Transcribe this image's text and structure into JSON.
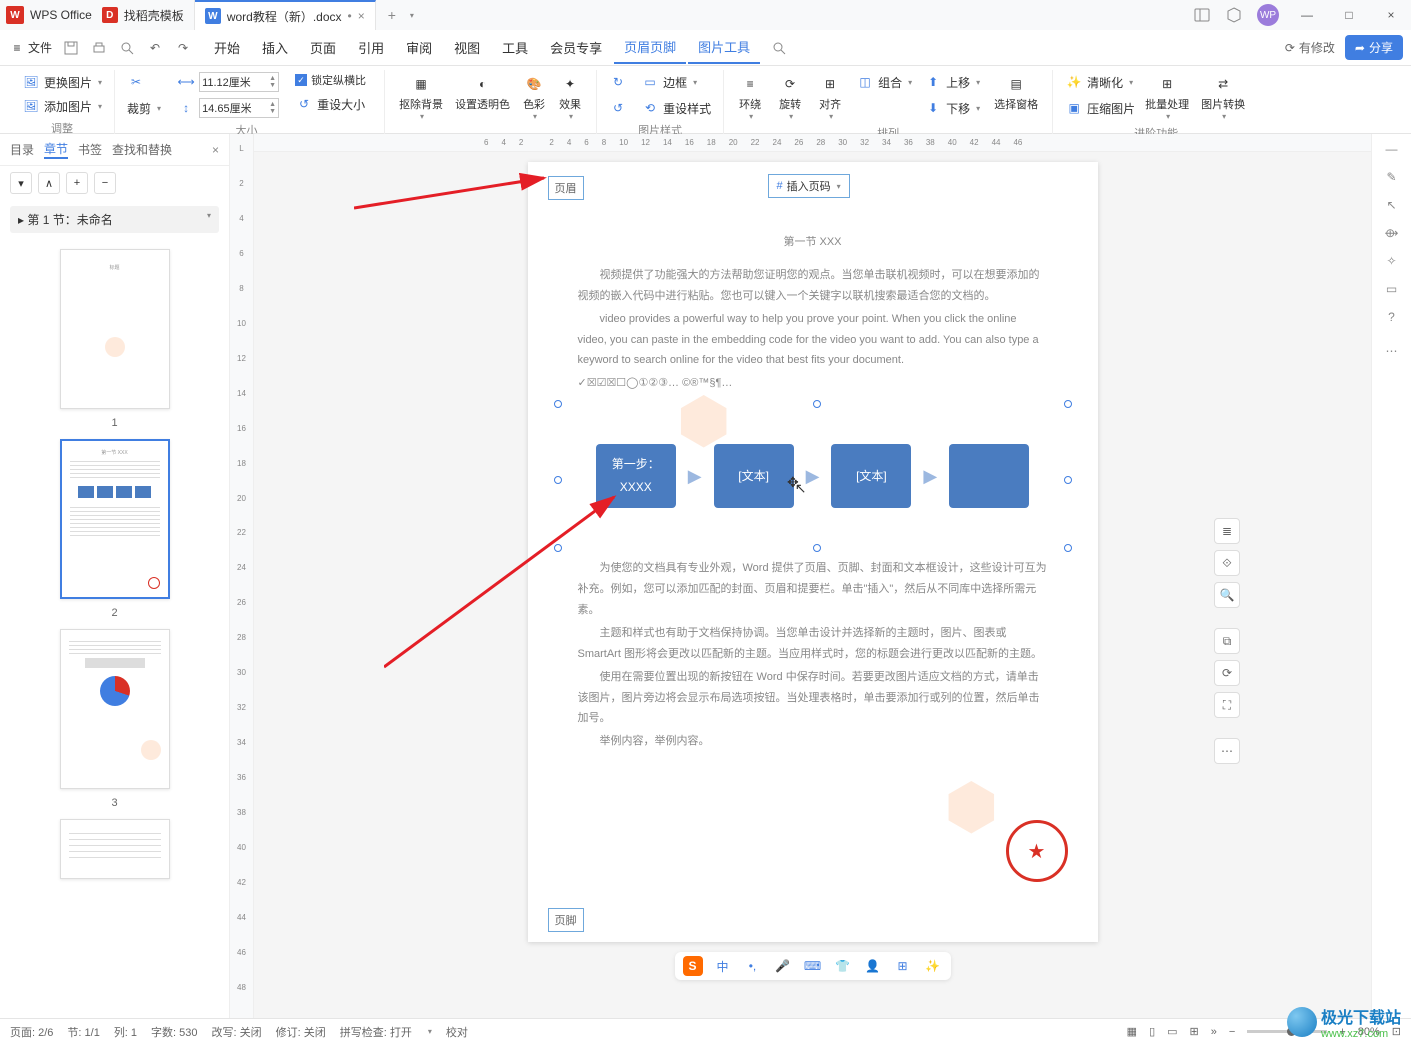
{
  "app": {
    "name": "WPS Office"
  },
  "tabs": [
    {
      "label": "找稻壳模板"
    },
    {
      "label": "word教程（新）.docx",
      "dirty": "•",
      "active": true
    }
  ],
  "avatar_initials": "WP",
  "menu_file": "文件",
  "menu": {
    "items": [
      "开始",
      "插入",
      "页面",
      "引用",
      "审阅",
      "视图",
      "工具",
      "会员专享",
      "页眉页脚",
      "图片工具"
    ],
    "active_indices": [
      8,
      9
    ]
  },
  "right_header": {
    "has_modify": "有修改",
    "share": "分享"
  },
  "ribbon": {
    "g1": {
      "change_pic": "更换图片",
      "add_pic": "添加图片",
      "label": "调整"
    },
    "g2": {
      "crop": "裁剪",
      "width": "11.12厘米",
      "height": "14.65厘米",
      "reset_size": "重设大小",
      "lock_ratio": "锁定纵横比",
      "label": "大小"
    },
    "g3": {
      "remove_bg": "抠除背景",
      "alpha": "设置透明色",
      "color": "色彩",
      "effect": "效果"
    },
    "g4": {
      "rotate_cw": "",
      "rotate_ccw": "",
      "border": "边框",
      "reset_style": "重设样式",
      "label": "图片样式"
    },
    "g5": {
      "wrap": "环绕",
      "rotate": "旋转",
      "align": "对齐",
      "group": "组合",
      "bring_fwd": "上移",
      "send_back": "下移",
      "select_pane": "选择窗格",
      "label": "排列"
    },
    "g6": {
      "clear": "清晰化",
      "compress": "压缩图片",
      "batch": "批量处理",
      "convert": "图片转换",
      "label": "进阶功能"
    }
  },
  "navpane": {
    "tabs": [
      "目录",
      "章节",
      "书签",
      "查找和替换"
    ],
    "active": 1,
    "section_title": "第 1 节：未命名",
    "thumb_numbers": [
      "1",
      "2",
      "3"
    ]
  },
  "ruler_h": [
    "6",
    "4",
    "2",
    "",
    "2",
    "4",
    "6",
    "8",
    "10",
    "12",
    "14",
    "16",
    "18",
    "20",
    "22",
    "24",
    "26",
    "28",
    "30",
    "32",
    "34",
    "36",
    "38",
    "40",
    "42",
    "44",
    "46"
  ],
  "ruler_v": [
    "L",
    "",
    "2",
    "",
    "4",
    "",
    "6",
    "",
    "8",
    "",
    "10",
    "",
    "12",
    "",
    "14",
    "",
    "16",
    "",
    "18",
    "",
    "20",
    "",
    "22",
    "",
    "24",
    "",
    "26",
    "",
    "28",
    "",
    "30",
    "",
    "32",
    "",
    "34",
    "",
    "36",
    "",
    "38",
    "",
    "40",
    "",
    "42",
    "",
    "44",
    "",
    "46",
    "",
    "48"
  ],
  "doc": {
    "header_label": "页眉",
    "footer_label": "页脚",
    "insert_pagenum": "插入页码",
    "section_title": "第一节  XXX",
    "para1": "视频提供了功能强大的方法帮助您证明您的观点。当您单击联机视频时，可以在想要添加的视频的嵌入代码中进行粘贴。您也可以键入一个关键字以联机搜索最适合您的文档的。",
    "para2": "video provides a powerful way to help you prove your point. When you click the online video, you can paste in the embedding code for the video you want to add. You can also type a keyword to search online for the video that best fits your document.",
    "symbols_line": "✓☒☑☒☐◯①②③…   ©®™§¶…",
    "flow": {
      "step1a": "第一步：",
      "step1b": "XXXX",
      "step2": "[文本]",
      "step3": "[文本]"
    },
    "para3": "为使您的文档具有专业外观，Word 提供了页眉、页脚、封面和文本框设计，这些设计可互为补充。例如，您可以添加匹配的封面、页眉和提要栏。单击\"插入\"，然后从不同库中选择所需元素。",
    "para4": "主题和样式也有助于文档保持协调。当您单击设计并选择新的主题时，图片、图表或 SmartArt 图形将会更改以匹配新的主题。当应用样式时，您的标题会进行更改以匹配新的主题。",
    "para5": "使用在需要位置出现的新按钮在 Word 中保存时间。若要更改图片适应文档的方式，请单击该图片，图片旁边将会显示布局选项按钮。当处理表格时，单击要添加行或列的位置，然后单击加号。",
    "para6": "举例内容，举例内容。",
    "smartart_label": "SmartArt"
  },
  "float_tools": [
    "crop-icon",
    "frame-icon",
    "zoom-icon",
    "copy-icon",
    "rotate-icon",
    "expand-icon",
    "more-icon"
  ],
  "statusbar": {
    "page": "页面: 2/6",
    "section": "节: 1/1",
    "col": "列: 1",
    "words": "字数: 530",
    "revision": "改写: 关闭",
    "track": "修订: 关闭",
    "spell": "拼写检查: 打开",
    "proofread": "校对",
    "zoom_pct": "80%"
  },
  "bottom_tb_icons": [
    "s-icon",
    "lang-icon",
    "sparkle-icon",
    "mic-icon",
    "keyboard-icon",
    "shirt-icon",
    "person-icon",
    "grid-icon",
    "sparkle2-icon"
  ],
  "bottom_tb_lang": "中",
  "corner_logo": {
    "name": "极光下载站",
    "url": "www.xz7.com"
  }
}
